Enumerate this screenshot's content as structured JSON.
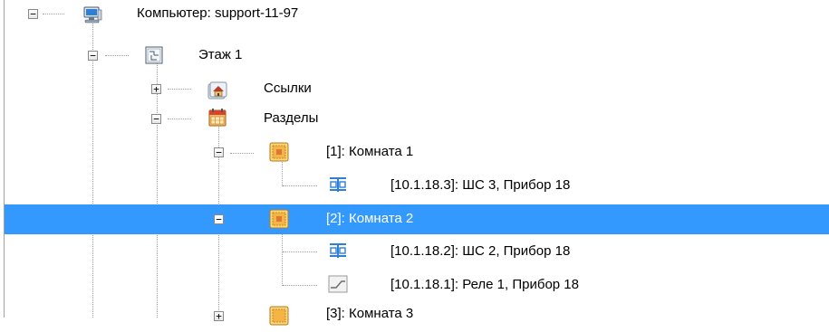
{
  "tree": {
    "computer": {
      "label": "Компьютер: support-11-97",
      "icon": "computer-icon",
      "expanded": true
    },
    "floor": {
      "label": "Этаж 1",
      "icon": "floor-plan-icon",
      "expanded": true
    },
    "links": {
      "label": "Ссылки",
      "icon": "house-links-icon",
      "expanded": false
    },
    "sections": {
      "label": "Разделы",
      "icon": "calendar-sections-icon",
      "expanded": true
    },
    "room1": {
      "label": "[1]: Комната 1",
      "icon": "room-icon",
      "expanded": true
    },
    "room1_loop": {
      "label": "[10.1.18.3]: ШС 3, Прибор 18",
      "icon": "loop-icon"
    },
    "room2": {
      "label": "[2]: Комната 2",
      "icon": "room-icon",
      "expanded": true,
      "selected": true
    },
    "room2_loop": {
      "label": "[10.1.18.2]: ШС 2, Прибор 18",
      "icon": "loop-icon"
    },
    "room2_relay": {
      "label": "[10.1.18.1]: Реле 1, Прибор 18",
      "icon": "relay-icon"
    },
    "room3": {
      "label": "[3]: Комната 3",
      "icon": "room-icon",
      "expanded": false
    }
  },
  "colors": {
    "selection": "#3399ff",
    "tree_lines": "#a0a0a0"
  }
}
